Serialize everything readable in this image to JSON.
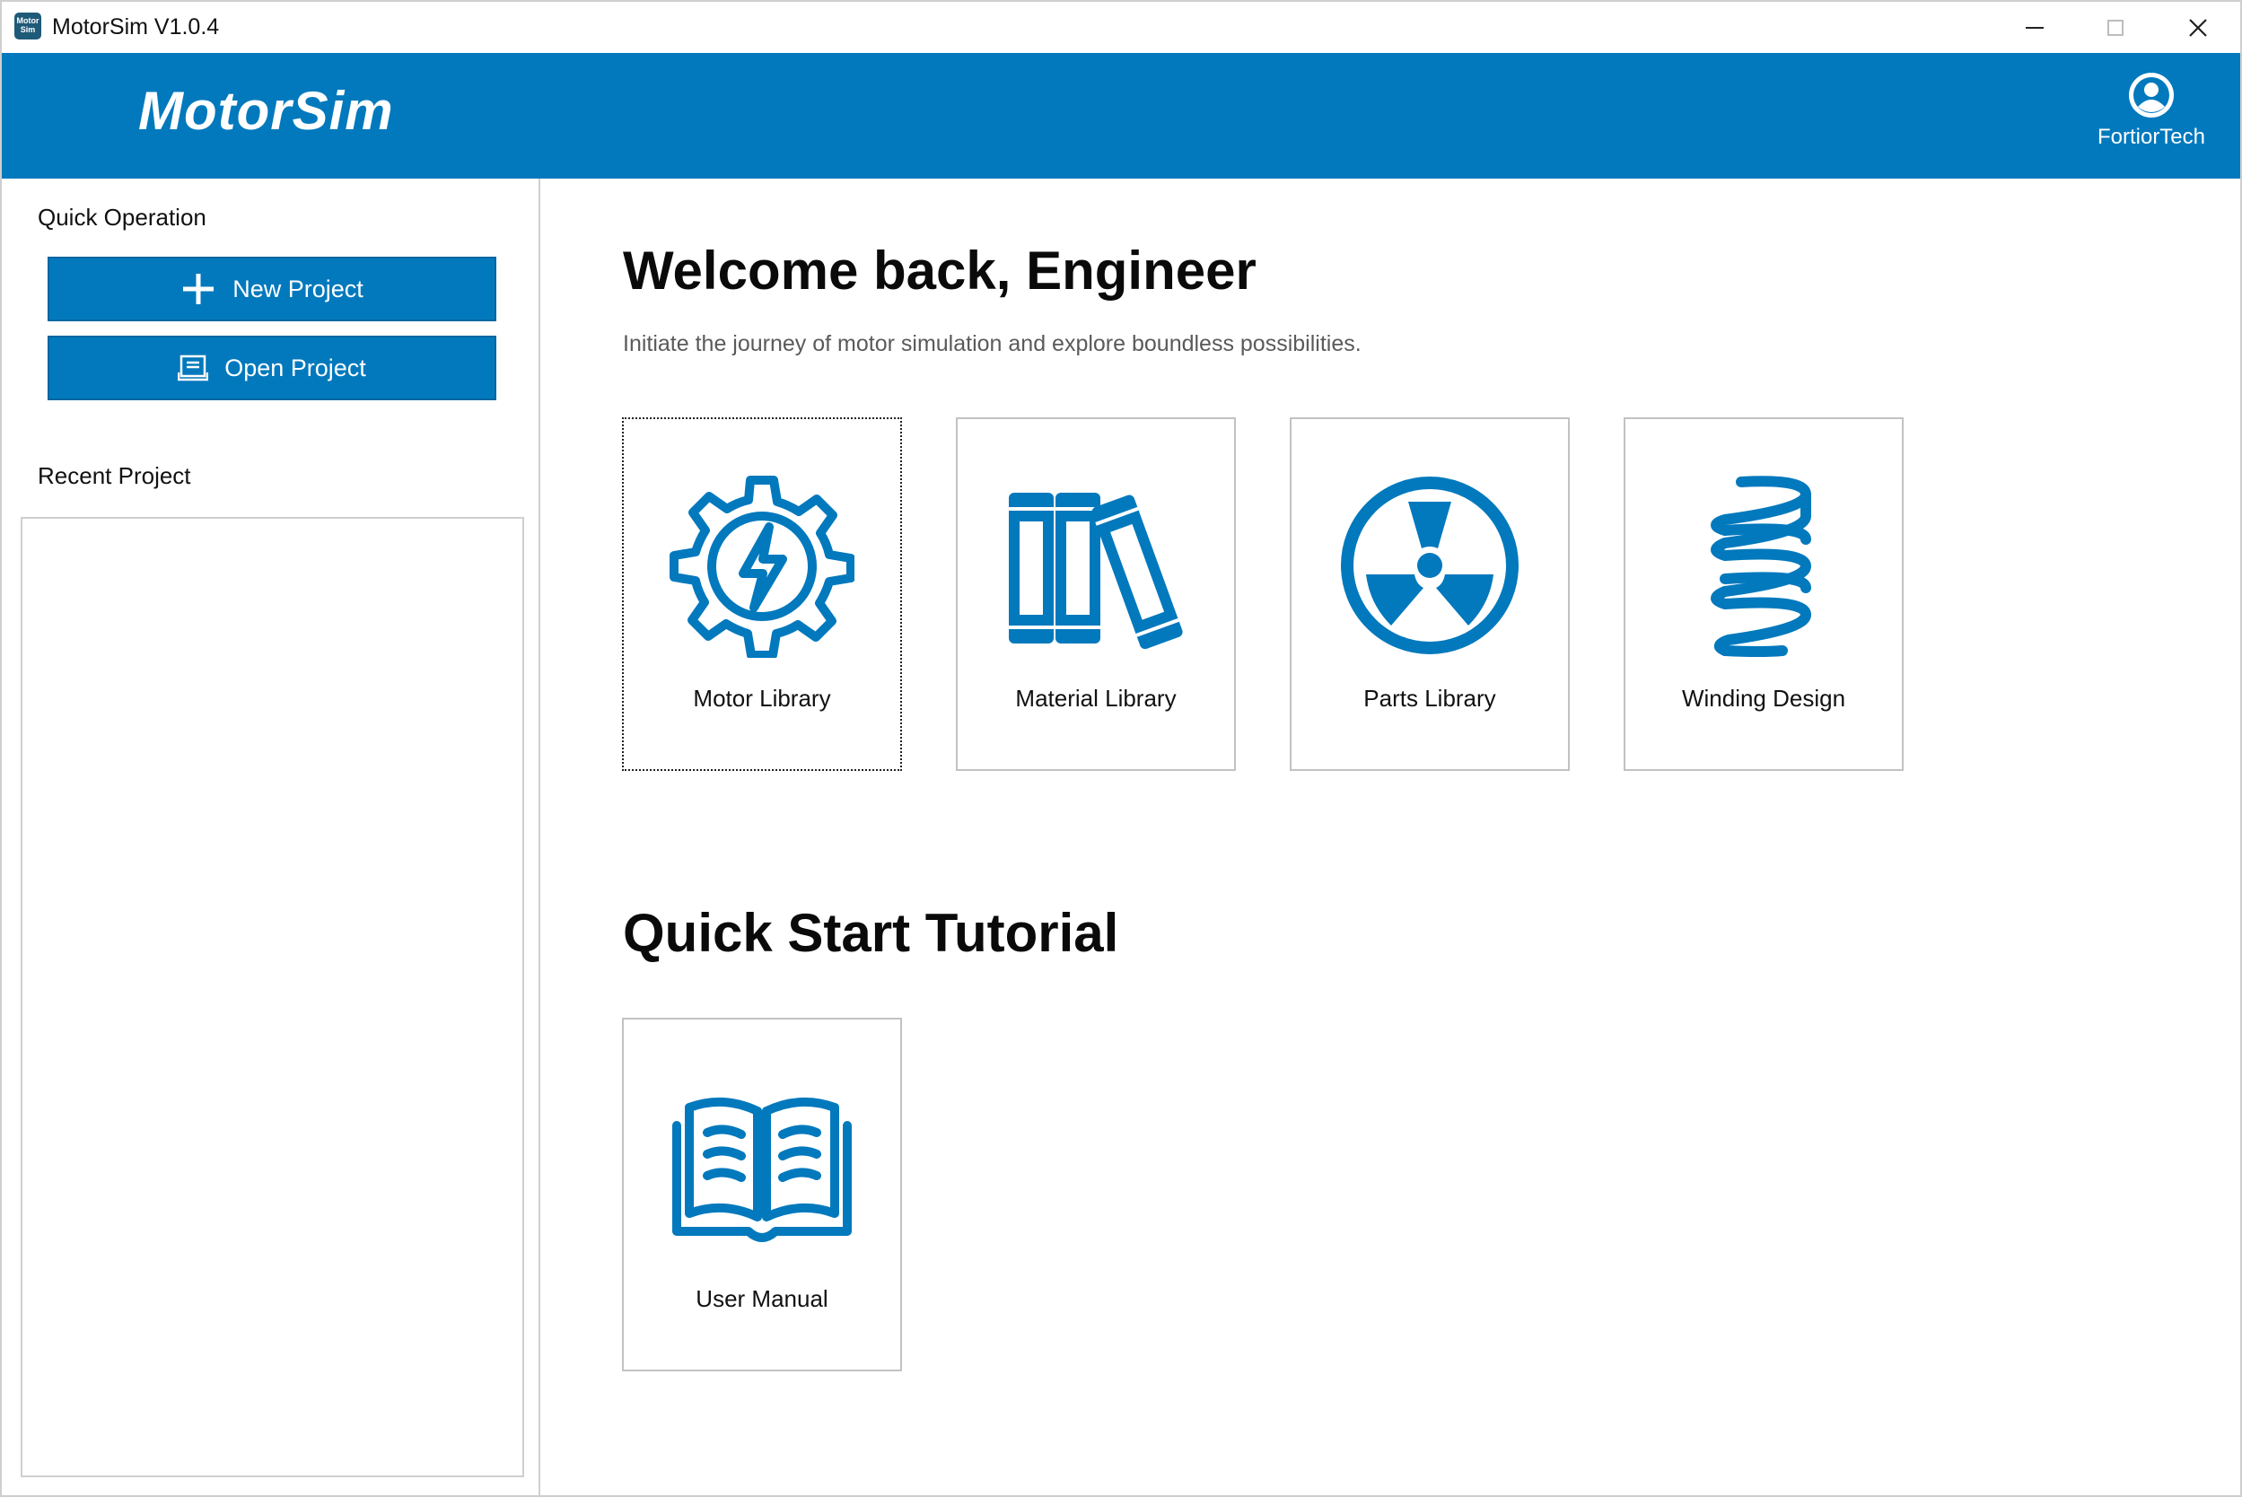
{
  "window": {
    "title": "MotorSim V1.0.4",
    "app_icon_text": "Motor Sim"
  },
  "header": {
    "brand": "MotorSim",
    "user_name": "FortiorTech"
  },
  "sidebar": {
    "quick_operation_heading": "Quick Operation",
    "new_project_label": "New Project",
    "open_project_label": "Open Project",
    "recent_project_heading": "Recent Project"
  },
  "main": {
    "welcome_title": "Welcome back, Engineer",
    "subtitle": "Initiate the journey of motor simulation and explore boundless possibilities.",
    "libraries": [
      {
        "label": "Motor Library",
        "icon": "gear-lightning-icon"
      },
      {
        "label": "Material Library",
        "icon": "books-icon"
      },
      {
        "label": "Parts Library",
        "icon": "fan-icon"
      },
      {
        "label": "Winding Design",
        "icon": "coil-icon"
      }
    ],
    "tutorial_title": "Quick Start Tutorial",
    "tutorials": [
      {
        "label": "User Manual",
        "icon": "open-book-icon"
      }
    ]
  },
  "colors": {
    "brand_blue": "#0279bd",
    "border_gray": "#c2c2c2"
  }
}
